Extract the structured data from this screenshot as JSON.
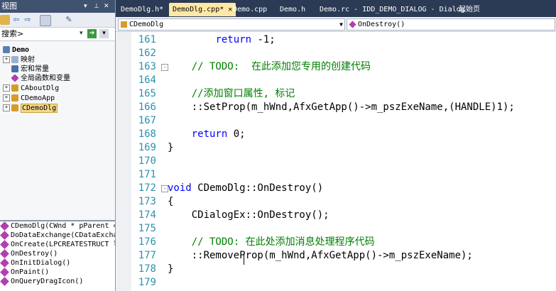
{
  "left_panel": {
    "title": "视图",
    "search": {
      "text": "搜索>"
    },
    "tree": [
      {
        "label": "Demo",
        "bold": true
      },
      {
        "label": "映射"
      },
      {
        "label": "宏和常量"
      },
      {
        "label": "全局函数和变量"
      },
      {
        "label": "CAboutDlg"
      },
      {
        "label": "CDemoApp"
      },
      {
        "label": "CDemoDlg",
        "selected": true
      }
    ],
    "members": [
      "CDemoDlg(CWnd * pParent = NU",
      "DoDataExchange(CDataExchange",
      "OnCreate(LPCREATESTRUCT lpCr",
      "OnDestroy()",
      "OnInitDialog()",
      "OnPaint()",
      "OnQueryDragIcon()"
    ]
  },
  "tabs": [
    {
      "label": "DemoDlg.h*"
    },
    {
      "label": "DemoDlg.cpp*",
      "active": true
    },
    {
      "label": "Demo.cpp"
    },
    {
      "label": "Demo.h"
    },
    {
      "label": "Demo.rc - IDD_DEMO_DIALOG - Dialog"
    },
    {
      "label": "起始页"
    }
  ],
  "navbar": {
    "class_combo": "CDemoDlg",
    "member_combo": "OnDestroy()"
  },
  "editor": {
    "lines": [
      {
        "num": "161",
        "parts": [
          {
            "t": "        ",
            "c": "tx"
          },
          {
            "t": "return",
            "c": "kw"
          },
          {
            "t": " -1;",
            "c": "tx"
          }
        ]
      },
      {
        "num": "162",
        "parts": []
      },
      {
        "num": "163",
        "fold": "-",
        "parts": [
          {
            "t": "    // TODO:  在此添加您专用的创建代码",
            "c": "cm"
          }
        ]
      },
      {
        "num": "164",
        "parts": []
      },
      {
        "num": "165",
        "parts": [
          {
            "t": "    //添加窗口属性, 标记",
            "c": "cm"
          }
        ]
      },
      {
        "num": "166",
        "parts": [
          {
            "t": "    ::SetProp(m_hWnd,AfxGetApp()->m_pszExeName,(HANDLE)1);",
            "c": "tx"
          }
        ]
      },
      {
        "num": "167",
        "parts": []
      },
      {
        "num": "168",
        "parts": [
          {
            "t": "    ",
            "c": "tx"
          },
          {
            "t": "return",
            "c": "kw"
          },
          {
            "t": " 0;",
            "c": "tx"
          }
        ]
      },
      {
        "num": "169",
        "parts": [
          {
            "t": "}",
            "c": "tx"
          }
        ]
      },
      {
        "num": "170",
        "parts": []
      },
      {
        "num": "171",
        "parts": []
      },
      {
        "num": "172",
        "fold": "-",
        "parts": [
          {
            "t": "void",
            "c": "kw"
          },
          {
            "t": " CDemoDlg::OnDestroy()",
            "c": "tx"
          }
        ]
      },
      {
        "num": "173",
        "parts": [
          {
            "t": "{",
            "c": "tx"
          }
        ]
      },
      {
        "num": "174",
        "parts": [
          {
            "t": "    CDialogEx::OnDestroy();",
            "c": "tx"
          }
        ]
      },
      {
        "num": "175",
        "parts": []
      },
      {
        "num": "176",
        "parts": [
          {
            "t": "    // TODO: 在此处添加消息处理程序代码",
            "c": "cm"
          }
        ]
      },
      {
        "num": "177",
        "parts": [
          {
            "t": "    ::RemoveProp(m_hWnd,AfxGetApp()->m_pszExeName);",
            "c": "tx"
          }
        ]
      },
      {
        "num": "178",
        "parts": [
          {
            "t": "}",
            "c": "tx"
          }
        ]
      },
      {
        "num": "179",
        "parts": []
      }
    ]
  },
  "colors": {
    "keyword": "#0000ff",
    "comment": "#008000",
    "line_number": "#2b91af",
    "active_tab": "#ffe8a6",
    "chrome": "#2b3b55"
  }
}
